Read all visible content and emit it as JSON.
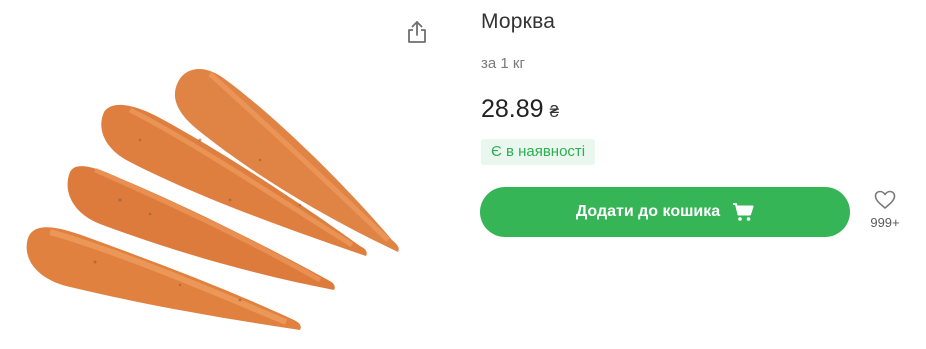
{
  "product": {
    "title": "Морква",
    "unit": "за 1 кг",
    "price": "28.89",
    "currency": "₴",
    "availability": "Є в наявності",
    "add_to_cart_label": "Додати до кошика",
    "favorites_count": "999+"
  },
  "icons": {
    "share": "share-icon",
    "cart": "cart-icon",
    "favorite": "heart-icon"
  },
  "colors": {
    "primary": "#35b556",
    "stock_badge_bg": "#eaf7ee",
    "stock_badge_text": "#2fae52"
  }
}
